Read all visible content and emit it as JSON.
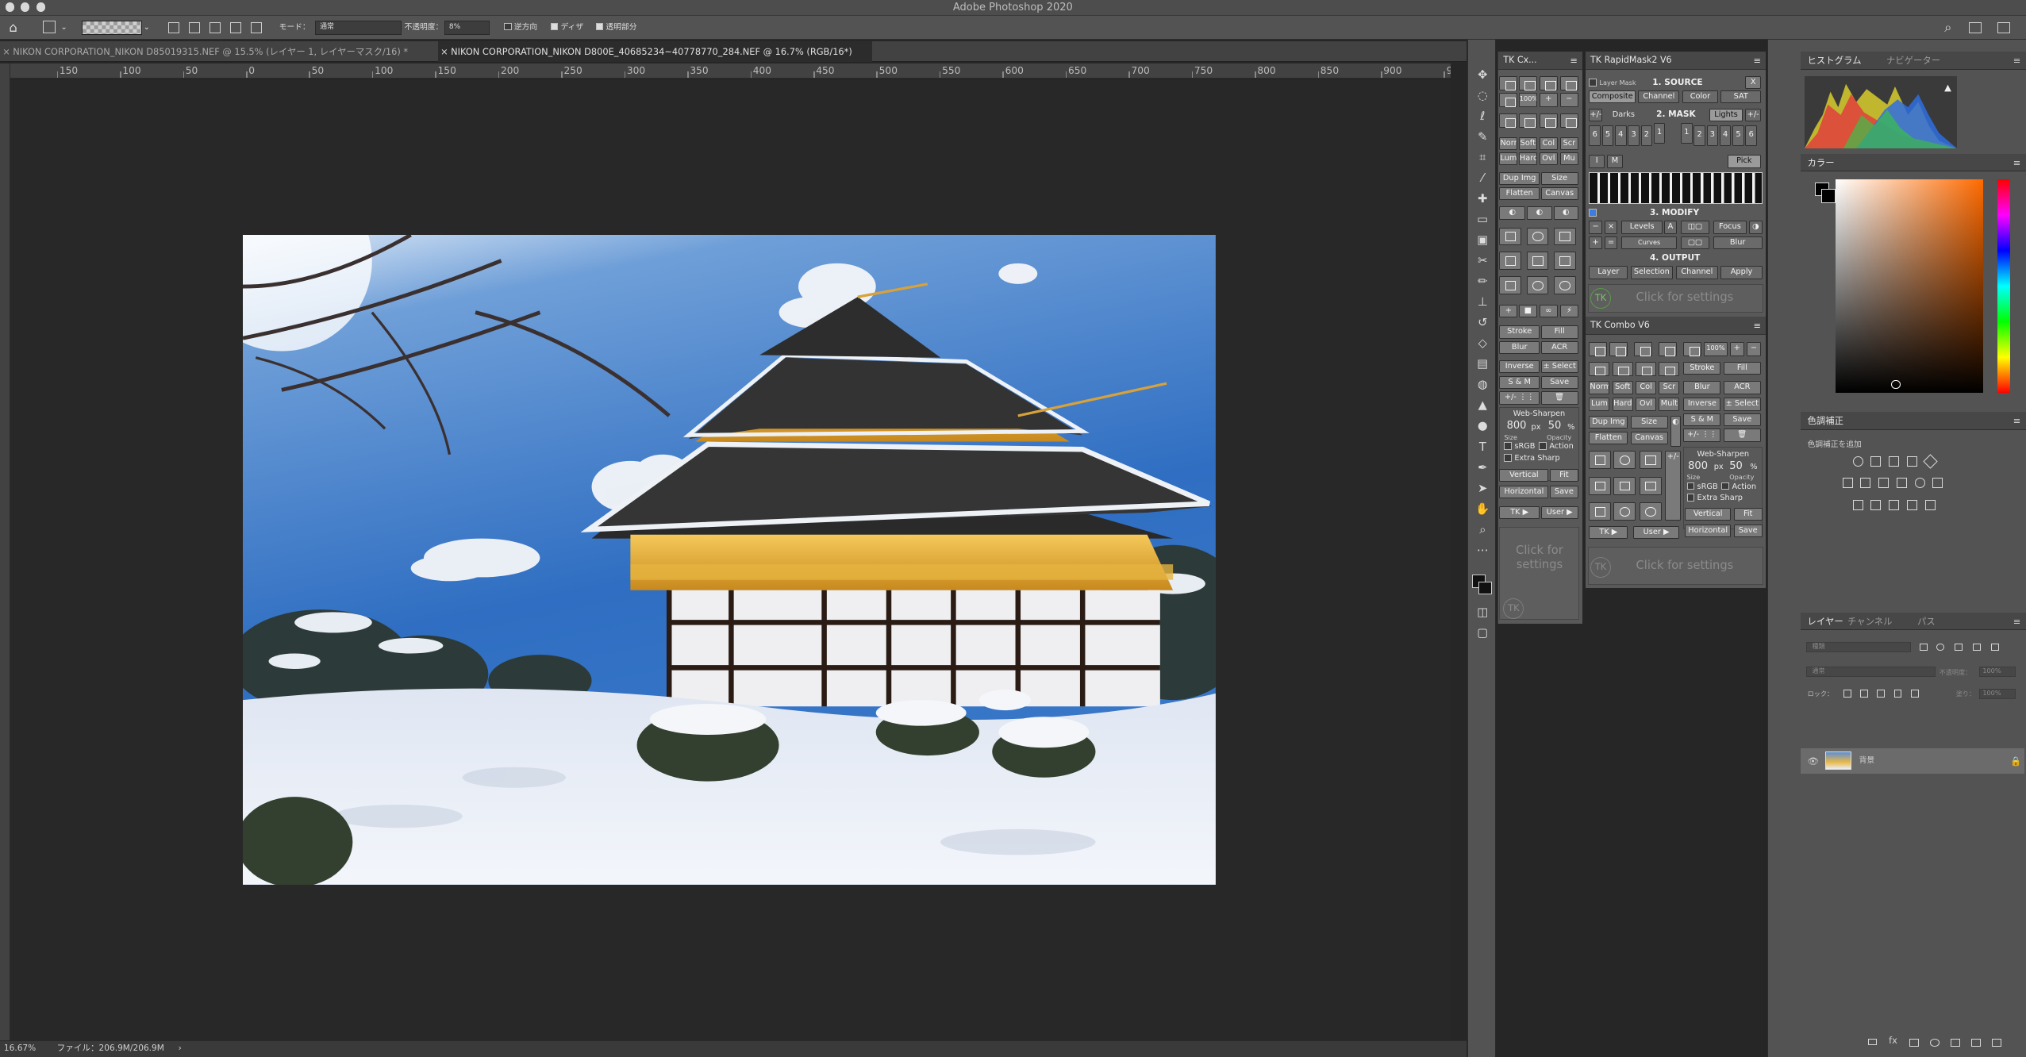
{
  "app": {
    "title": "Adobe Photoshop 2020"
  },
  "options": {
    "mode_label": "モード：",
    "mode_value": "通常",
    "opacity_label": "不透明度：",
    "opacity_value": "8%",
    "reverse_label": "逆方向",
    "dither_label": "ディザ",
    "transparency_label": "透明部分"
  },
  "tabs": [
    {
      "label": "NIKON CORPORATION_NIKON D85019315.NEF @ 15.5% (レイヤー 1, レイヤーマスク/16) *"
    },
    {
      "label": "NIKON CORPORATION_NIKON D800E_40685234~40778770_284.NEF @ 16.7% (RGB/16*)"
    }
  ],
  "ruler": {
    "labels": [
      "150",
      "100",
      "50",
      "0",
      "50",
      "100",
      "150",
      "200",
      "250",
      "300",
      "350",
      "400",
      "450",
      "500",
      "550",
      "600",
      "650",
      "700",
      "750",
      "800",
      "850",
      "900",
      "950"
    ]
  },
  "status": {
    "zoom": "16.67%",
    "file": "ファイル：206.9M/206.9M"
  },
  "tkcx": {
    "title": "TK Cx...",
    "zoom": "100%",
    "blend": [
      "Norm",
      "Soft",
      "Col",
      "Scr",
      "Lum",
      "Hard",
      "Ovl",
      "Mu"
    ],
    "dup": "Dup Img",
    "size": "Size",
    "flatten": "Flatten",
    "canvas": "Canvas",
    "stroke": "Stroke",
    "fill": "Fill",
    "blur": "Blur",
    "acr": "ACR",
    "inverse": "Inverse",
    "select": "± Select",
    "sm": "S & M",
    "save": "Save",
    "sharpen": "Web-Sharpen",
    "px": "800",
    "pxu": "px",
    "pct": "50",
    "pctu": "%",
    "size_sm": "Size",
    "opacity_sm": "Opacity",
    "srgb": "sRGB",
    "action": "Action",
    "extra": "Extra Sharp",
    "vertical": "Vertical",
    "fit": "Fit",
    "horizontal": "Horizontal",
    "save2": "Save",
    "tk": "TK ▶",
    "user": "User ▶",
    "cfs": "Click for settings",
    "logo": "TK"
  },
  "rm2": {
    "title": "TK RapidMask2 V6",
    "layermask": "Layer Mask",
    "source": "1. SOURCE",
    "x": "X",
    "composite": "Composite",
    "channel": "Channel",
    "color": "Color",
    "sat": "SAT",
    "darks": "Darks",
    "mask": "2. MASK",
    "lights": "Lights",
    "nums_l": [
      "6",
      "5",
      "4",
      "3",
      "2",
      "1"
    ],
    "nums_r": [
      "1",
      "2",
      "3",
      "4",
      "5",
      "6"
    ],
    "i": "I",
    "m": "M",
    "pick": "Pick",
    "modify": "3. MODIFY",
    "levels": "Levels",
    "a": "A",
    "focus": "Focus",
    "curves": "Curves",
    "blur": "Blur",
    "output": "4. OUTPUT",
    "layer": "Layer",
    "selection": "Selection",
    "channel2": "Channel",
    "apply": "Apply",
    "cfs": "Click for settings",
    "logo": "TK"
  },
  "combo": {
    "title": "TK Combo V6",
    "zoom": "100%",
    "stroke": "Stroke",
    "fill": "Fill",
    "blend": [
      "Norm",
      "Soft",
      "Col",
      "Scr",
      "Lum",
      "Hard",
      "Ovl",
      "Mult"
    ],
    "blur": "Blur",
    "acr": "ACR",
    "inverse": "Inverse",
    "select": "± Select",
    "dup": "Dup Img",
    "size": "Size",
    "sm": "S & M",
    "save": "Save",
    "flatten": "Flatten",
    "canvas": "Canvas",
    "sharpen": "Web-Sharpen",
    "px": "800",
    "pxu": "px",
    "pct": "50",
    "pctu": "%",
    "size_sm": "Size",
    "opacity_sm": "Opacity",
    "srgb": "sRGB",
    "action": "Action",
    "extra": "Extra Sharp",
    "vertical": "Vertical",
    "fit": "Fit",
    "horizontal": "Horizontal",
    "save2": "Save",
    "tk": "TK ▶",
    "user": "User ▶",
    "cfs": "Click for settings",
    "logo": "TK"
  },
  "right": {
    "histogram": "ヒストグラム",
    "navigator": "ナビゲーター",
    "color": "カラー",
    "adjustments": "色調補正",
    "add_adjust": "色調補正を追加",
    "layers": "レイヤー",
    "channels": "チャンネル",
    "paths": "パス",
    "kind": "種類",
    "normal": "通常",
    "opacity": "不透明度：",
    "opacity_value": "100%",
    "lock": "ロック：",
    "fill": "塗り：",
    "fill_value": "100%",
    "layer_name": "背景"
  },
  "colors": {
    "accent": "#2d6ed8",
    "panel": "#535353",
    "button": "#7a7a7a"
  }
}
